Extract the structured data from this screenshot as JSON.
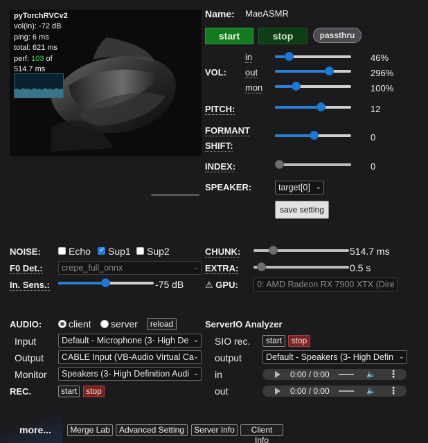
{
  "stats": {
    "model": "pyTorchRVCv2",
    "vol_in": "vol(in): -72 dB",
    "ping": "ping: 6 ms",
    "total": "total: 621 ms",
    "perf_prefix": "perf:",
    "perf_value": "103",
    "perf_suffix": "of",
    "perf_total": "514.7 ms"
  },
  "header": {
    "name_label": "Name:",
    "name_value": "MaeASMR",
    "start_label": "start",
    "stop_label": "stop",
    "passthru_label": "passthru"
  },
  "vol": {
    "label": "VOL:",
    "in": {
      "label": "in",
      "value": "46%",
      "level": 0.18
    },
    "out": {
      "label": "out",
      "value": "296%",
      "level": 0.71
    },
    "mon": {
      "label": "mon",
      "value": "100%",
      "level": 0.27
    }
  },
  "pitch": {
    "label": "PITCH:",
    "value": "12",
    "level": 0.6
  },
  "formant": {
    "label1": "FORMANT",
    "label2": "SHIFT:",
    "value": "0",
    "level": 0.51
  },
  "index": {
    "label": "INDEX:",
    "value": "0",
    "level": 0.0
  },
  "speaker": {
    "label": "SPEAKER:",
    "selected": "target[0]",
    "save_label": "save setting"
  },
  "noise": {
    "label": "NOISE:",
    "echo": {
      "label": "Echo",
      "checked": false
    },
    "sup1": {
      "label": "Sup1",
      "checked": true
    },
    "sup2": {
      "label": "Sup2",
      "checked": false
    }
  },
  "f0": {
    "label": "F0 Det.:",
    "selected": "crepe_full_onnx"
  },
  "in_sens": {
    "label": "In. Sens.:",
    "value": "-75 dB",
    "level": 0.49
  },
  "chunk": {
    "label": "CHUNK:",
    "value": "514.7 ms",
    "level": 0.2
  },
  "extra": {
    "label": "EXTRA:",
    "value": "0.5 s",
    "level": 0.08
  },
  "gpu": {
    "label": "GPU:",
    "warning_icon": "warning-icon",
    "selected": "0: AMD Radeon RX 7900 XTX (Dire"
  },
  "audio": {
    "label": "AUDIO:",
    "client_label": "client",
    "server_label": "server",
    "mode": "client",
    "reload_label": "reload",
    "input_label": "Input",
    "input_value": "Default - Microphone (3- High De",
    "output_label": "Output",
    "output_value": "CABLE Input (VB-Audio Virtual Ca",
    "monitor_label": "Monitor",
    "monitor_value": "Speakers (3- High Definition Audi",
    "rec_label": "REC.",
    "rec_start": "start",
    "rec_stop": "stop"
  },
  "serverio": {
    "title": "ServerIO Analyzer",
    "sio_label": "SIO rec.",
    "sio_start": "start",
    "sio_stop": "stop",
    "output_label": "output",
    "output_value": "Default - Speakers (3- High Defin",
    "in_label": "in",
    "out_label": "out",
    "in_time": "0:00 / 0:00",
    "out_time": "0:00 / 0:00"
  },
  "footer": {
    "more_label": "more...",
    "merge_lab": "Merge Lab",
    "advanced_setting": "Advanced Setting",
    "server_info": "Server Info",
    "client_info": "Client Info"
  },
  "colors": {
    "accent": "#2a7fd4",
    "start_green": "#147a1f",
    "perf_green": "#39d44a",
    "stop_red": "#7a2222"
  }
}
